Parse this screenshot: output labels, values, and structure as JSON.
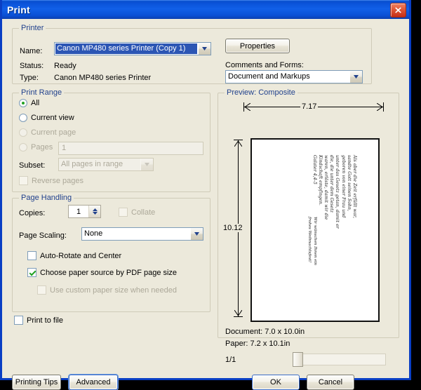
{
  "window": {
    "title": "Print",
    "close_icon": "close-icon"
  },
  "printer": {
    "legend": "Printer",
    "name_label": "Name:",
    "name_value": "Canon MP480 series Printer (Copy 1)",
    "status_label": "Status:",
    "status_value": "Ready",
    "type_label": "Type:",
    "type_value": "Canon MP480 series Printer",
    "properties_button": "Properties",
    "comments_label": "Comments and Forms:",
    "comments_value": "Document and Markups"
  },
  "print_range": {
    "legend": "Print Range",
    "all": "All",
    "current_view": "Current view",
    "current_page": "Current page",
    "pages": "Pages",
    "pages_value": "1",
    "subset_label": "Subset:",
    "subset_value": "All pages in range",
    "reverse_pages": "Reverse pages"
  },
  "page_handling": {
    "legend": "Page Handling",
    "copies_label": "Copies:",
    "copies_value": "1",
    "collate": "Collate",
    "scaling_label": "Page Scaling:",
    "scaling_value": "None",
    "auto_rotate": "Auto-Rotate and Center",
    "choose_source": "Choose paper source by PDF page size",
    "custom_paper": "Use custom paper size when needed"
  },
  "print_to_file": "Print to file",
  "preview": {
    "legend": "Preview: Composite",
    "width_dim": "7.17",
    "height_dim": "10.12",
    "document_info": "Document: 7.0 x 10.0in",
    "paper_info": "Paper: 7.2 x 10.1in",
    "page_counter": "1/1",
    "page_text_lines": [
      "Als aber die Zeit erfüllt war,",
      "sandte Gott seinen Sohn,",
      "geboren von einer Frau und",
      "unter das Gesetz getan, damit er",
      "die, die unter dem Gesetz",
      "waren, erlöste, damit wir die",
      "Kindschaft empfingen.",
      "Galater 4,4-5"
    ],
    "page_greeting_lines": [
      "Wir wünschen Ihnen ein",
      "frohes Weihnachtsfest!"
    ]
  },
  "buttons": {
    "printing_tips": "Printing Tips",
    "advanced": "Advanced",
    "ok": "OK",
    "cancel": "Cancel"
  },
  "colors": {
    "dialog_bg": "#ECE9DB",
    "title_blue": "#0A4FD0",
    "group_legend": "#21418C",
    "selection_blue": "#2C56B4",
    "radio_green": "#21A121"
  }
}
